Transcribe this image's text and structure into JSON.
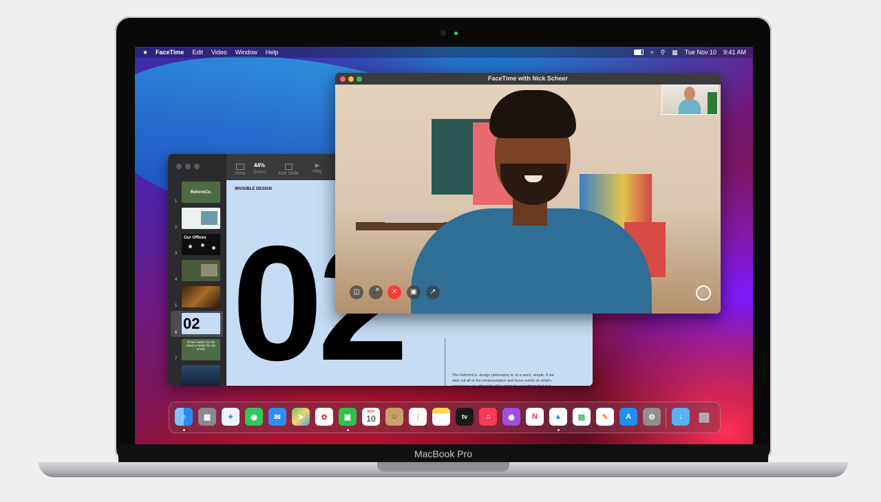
{
  "device": {
    "model_label": "MacBook Pro"
  },
  "menubar": {
    "app_name": "FaceTime",
    "items": [
      "Edit",
      "Video",
      "Window",
      "Help"
    ],
    "date": "Tue Nov 10",
    "time": "9:41 AM"
  },
  "keynote": {
    "zoom": "44%",
    "toolbar": [
      {
        "label": "View"
      },
      {
        "label": "Zoom"
      },
      {
        "label": "Add Slide"
      },
      {
        "label": "Play"
      }
    ],
    "slides": [
      {
        "num": "1",
        "title": "ReformCo."
      },
      {
        "num": "2",
        "title": ""
      },
      {
        "num": "3",
        "title": "Our Offices"
      },
      {
        "num": "4",
        "title": ""
      },
      {
        "num": "5",
        "title": ""
      },
      {
        "num": "6",
        "title": "02"
      },
      {
        "num": "7",
        "title": "What's better for the client is better for the world."
      },
      {
        "num": "8",
        "title": ""
      }
    ],
    "slide": {
      "heading": "INVISIBLE DESIGN",
      "big_number": "02",
      "body": "The ReformCo. design philosophy is, in a word, simple. If we strip out all of the ornamentation and focus solely on what's necessary, we ultimately allow room for everything that truly matters: the warmth of sunlight, the nourishment of foliage, the company of friends, and the pleasant chaos of life itself."
    }
  },
  "facetime": {
    "title": "FaceTime with Nick Scheer"
  },
  "dock": {
    "apps": [
      {
        "name": "Finder",
        "icon": "finder-icon",
        "color": "#2a8cf0"
      },
      {
        "name": "Launchpad",
        "icon": "launchpad-icon",
        "color": "#8a8a94"
      },
      {
        "name": "Safari",
        "icon": "safari-icon",
        "color": "#3da0f5"
      },
      {
        "name": "Messages",
        "icon": "messages-icon",
        "color": "#33c759"
      },
      {
        "name": "Mail",
        "icon": "mail-icon",
        "color": "#2f8ef5"
      },
      {
        "name": "Maps",
        "icon": "maps-icon",
        "color": "#6dc36a"
      },
      {
        "name": "Photos",
        "icon": "photos-icon",
        "color": "#f4b93c"
      },
      {
        "name": "FaceTime",
        "icon": "facetime-icon",
        "color": "#2cc24c"
      },
      {
        "name": "Calendar",
        "icon": "calendar-icon",
        "color": "#ffffff",
        "month": "NOV",
        "day": "10"
      },
      {
        "name": "Contacts",
        "icon": "contacts-icon",
        "color": "#c8a06a"
      },
      {
        "name": "Reminders",
        "icon": "reminders-icon",
        "color": "#ffffff"
      },
      {
        "name": "Notes",
        "icon": "notes-icon",
        "color": "#ffd84d"
      },
      {
        "name": "TV",
        "icon": "tv-icon",
        "color": "#1a1a1a",
        "label": "tv"
      },
      {
        "name": "Music",
        "icon": "music-icon",
        "color": "#fa3a55"
      },
      {
        "name": "Podcasts",
        "icon": "podcasts-icon",
        "color": "#a04ee0"
      },
      {
        "name": "News",
        "icon": "news-icon",
        "color": "#ffffff"
      },
      {
        "name": "Keynote",
        "icon": "keynote-icon",
        "color": "#ffffff"
      },
      {
        "name": "Numbers",
        "icon": "numbers-icon",
        "color": "#ffffff"
      },
      {
        "name": "Pages",
        "icon": "pages-icon",
        "color": "#ffffff"
      },
      {
        "name": "App Store",
        "icon": "appstore-icon",
        "color": "#1f8ef7"
      },
      {
        "name": "System Preferences",
        "icon": "settings-icon",
        "color": "#8e8e93"
      },
      {
        "name": "Downloads",
        "icon": "downloads-folder-icon",
        "color": "#5ab0f0"
      },
      {
        "name": "Trash",
        "icon": "trash-icon",
        "color": "#b0b0b6"
      }
    ]
  }
}
